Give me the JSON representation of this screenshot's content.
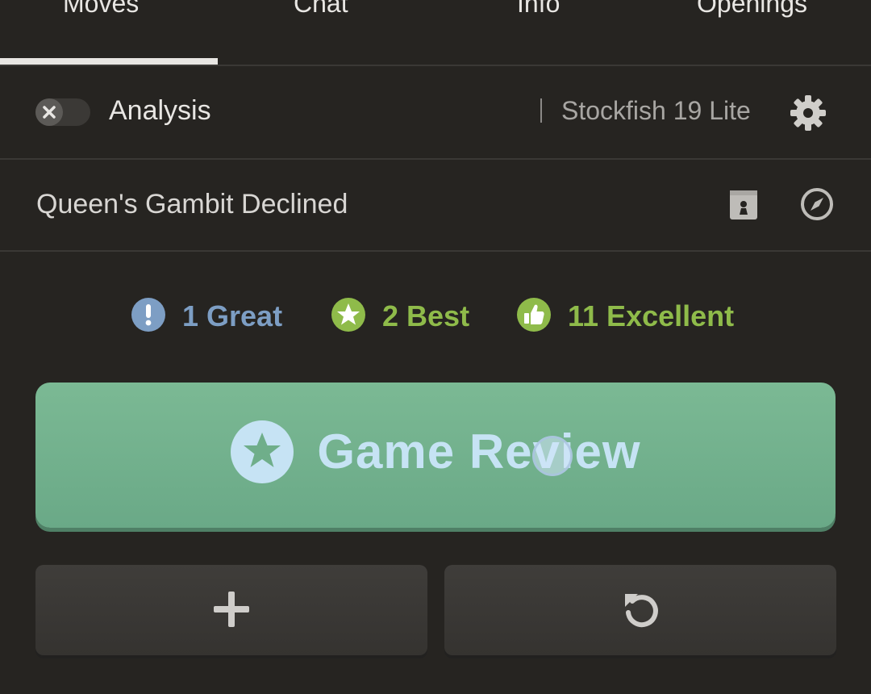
{
  "tabs": [
    {
      "label": "Moves",
      "active": true
    },
    {
      "label": "Chat",
      "active": false
    },
    {
      "label": "Info",
      "active": false
    },
    {
      "label": "Openings",
      "active": false
    }
  ],
  "analysis": {
    "label": "Analysis",
    "toggle_on": false,
    "engine": "Stockfish 19 Lite",
    "settings_icon": "gear-icon"
  },
  "opening": {
    "name": "Queen's Gambit Declined",
    "book_icon": "book-icon",
    "explorer_icon": "compass-icon"
  },
  "stats": {
    "great": {
      "count": 1,
      "text": "1 Great",
      "icon": "exclamation-icon",
      "color": "#7d9ec4"
    },
    "best": {
      "count": 2,
      "text": "2 Best",
      "icon": "star-icon",
      "color": "#8fbb4a"
    },
    "excellent": {
      "count": 11,
      "text": "11 Excellent",
      "icon": "thumbs-up-icon",
      "color": "#8fbb4a"
    }
  },
  "review_button": {
    "label": "Game Review",
    "icon": "star-icon",
    "color": "#6fae8a"
  },
  "actions": {
    "new_game_icon": "plus-icon",
    "rematch_icon": "refresh-icon"
  }
}
